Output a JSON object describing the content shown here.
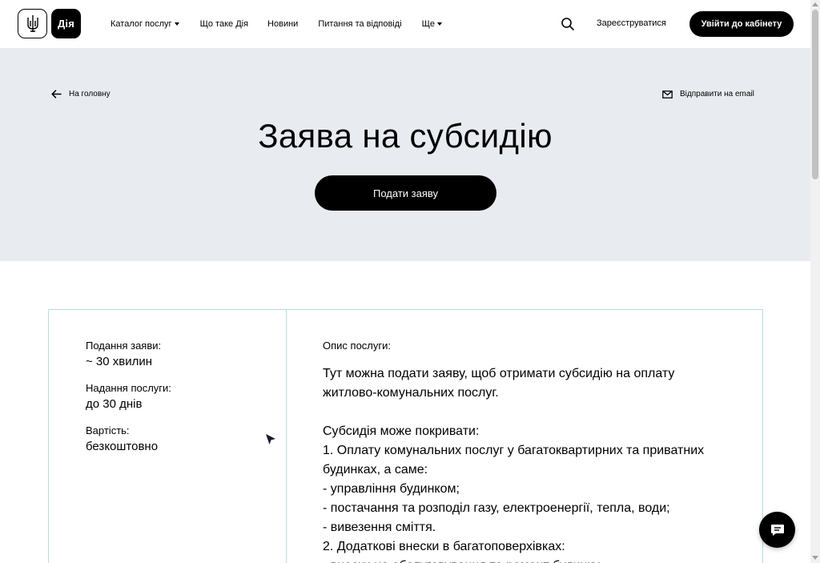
{
  "header": {
    "logo_text": "Дія",
    "nav": [
      {
        "label": "Каталог послуг",
        "has_dropdown": true
      },
      {
        "label": "Що таке Дія",
        "has_dropdown": false
      },
      {
        "label": "Новини",
        "has_dropdown": false
      },
      {
        "label": "Питання та відповіді",
        "has_dropdown": false
      },
      {
        "label": "Ще",
        "has_dropdown": true
      }
    ],
    "register_label": "Зареєструватися",
    "login_label": "Увійти до кабінету"
  },
  "hero": {
    "back_label": "На головну",
    "email_label": "Відправити на email",
    "title": "Заява на субсидію",
    "apply_label": "Подати заяву"
  },
  "info": [
    {
      "label": "Подання заяви:",
      "value": "~ 30 хвилин"
    },
    {
      "label": "Надання послуги:",
      "value": "до 30 днів"
    },
    {
      "label": "Вартість:",
      "value": "безкоштовно"
    }
  ],
  "description": {
    "label": "Опис послуги:",
    "intro": "Тут можна подати заяву, щоб отримати субсидію на оплату житлово-комунальних послуг.",
    "lines": [
      "Субсидія може покривати:",
      "1. Оплату комунальних послуг у багатоквартирних та приватних будинках, а саме:",
      "- управління будинком;",
      "- постачання та розподіл газу, електроенергії, тепла, води;",
      "- вивезення сміття.",
      "2. Додаткові внески в багатоповерхівках:",
      "- внески на обслуговування та ремонт будинку"
    ]
  },
  "colors": {
    "hero_bg": "#e8ecf1",
    "card_border": "#b7dfdc",
    "primary": "#000000"
  }
}
